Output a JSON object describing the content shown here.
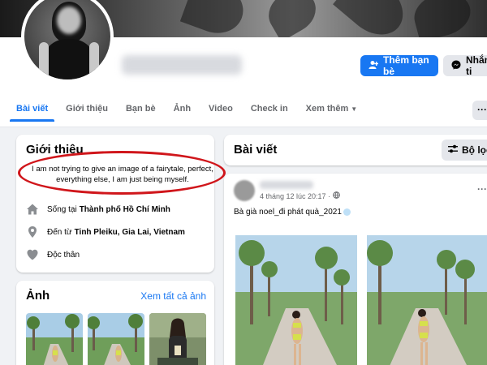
{
  "profile": {
    "add_friend_label": "Thêm bạn bè",
    "message_label": "Nhắn ti",
    "accent_color": "#1877f2"
  },
  "tabs": [
    {
      "label": "Bài viết",
      "active": true
    },
    {
      "label": "Giới thiệu"
    },
    {
      "label": "Bạn bè"
    },
    {
      "label": "Ảnh"
    },
    {
      "label": "Video"
    },
    {
      "label": "Check in"
    },
    {
      "label": "Xem thêm"
    }
  ],
  "more_button_label": "···",
  "intro": {
    "title": "Giới thiệu",
    "bio": "I am not trying to give an image of a fairytale, perfect, everything else, I am just being myself.",
    "highlight_color": "#d0161b",
    "lives_prefix": "Sống tại",
    "lives_value": "Thành phố Hồ Chí Minh",
    "from_prefix": "Đến từ",
    "from_value": "Tinh Pleiku, Gia Lai, Vietnam",
    "relationship": "Độc thân"
  },
  "photos": {
    "title": "Ảnh",
    "see_all": "Xem tất cả ảnh"
  },
  "posts": {
    "title": "Bài viết",
    "filter_label": "Bộ lọc",
    "post": {
      "timestamp": "4 tháng 12 lúc 20:17 ·",
      "text": "Bà già noel_đi phát quà_2021",
      "more_dots": "···"
    }
  }
}
